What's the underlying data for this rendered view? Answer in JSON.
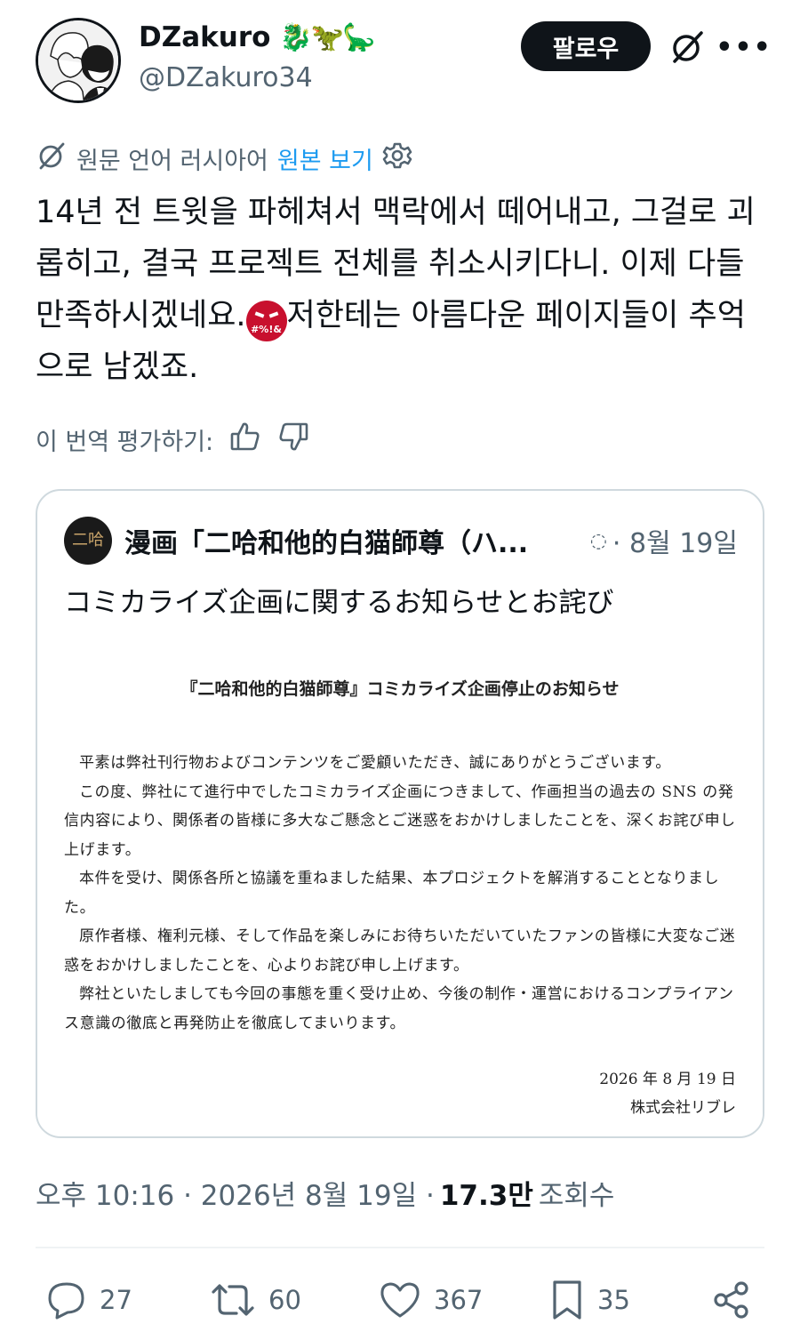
{
  "user": {
    "display_name": "DZakuro",
    "name_emoji": "🐉🦖🦕",
    "handle": "@DZakuro34",
    "follow_label": "팔로우"
  },
  "translation": {
    "source_label": "원문 언어 러시아어",
    "view_original": "원본 보기"
  },
  "tweet": {
    "text_before_emoji": "14년 전 트윗을 파헤쳐서 맥락에서 떼어내고, 그걸로 괴롭히고, 결국 프로젝트 전체를 취소시키다니. 이제 다들 만족하시겠네요.",
    "emoji_text": "#%!&",
    "text_after_emoji": "저한테는 아름다운 페이지들이 추억으로 남겠죠."
  },
  "rate": {
    "label": "이 번역 평가하기:"
  },
  "quote": {
    "avatar_text": "二哈",
    "name": "漫画「二哈和他的白猫師尊（ハ...",
    "date": "· 8월 19일",
    "text": "コミカライズ企画に関するお知らせとお詫び",
    "notice_title": "『二哈和他的白猫師尊』コミカライズ企画停止のお知らせ",
    "notice_paragraphs": [
      "平素は弊社刊行物およびコンテンツをご愛顧いただき、誠にありがとうございます。",
      "この度、弊社にて進行中でしたコミカライズ企画につきまして、作画担当の過去の SNS の発信内容により、関係者の皆様に多大なご懸念とご迷惑をおかけしましたことを、深くお詫び申し上げます。",
      "本件を受け、関係各所と協議を重ねました結果、本プロジェクトを解消することとなりました。",
      "原作者様、権利元様、そして作品を楽しみにお待ちいただいていたファンの皆様に大変なご迷惑をおかけしましたことを、心よりお詫び申し上げます。",
      "弊社といたしましても今回の事態を重く受け止め、今後の制作・運営におけるコンプライアンス意識の徹底と再発防止を徹底してまいります。"
    ],
    "notice_date": "2026 年 8 月 19 日",
    "notice_company": "株式会社リブレ"
  },
  "meta": {
    "timestamp": "오후 10:16 · 2026년 8월 19일 ·",
    "views_count": "17.3만",
    "views_label": "조회수"
  },
  "actions": {
    "replies": "27",
    "reposts": "60",
    "likes": "367",
    "bookmarks": "35"
  },
  "colors": {
    "text": "#0f1419",
    "muted": "#536471",
    "link": "#1d9bf0",
    "border": "#cfd9de"
  }
}
